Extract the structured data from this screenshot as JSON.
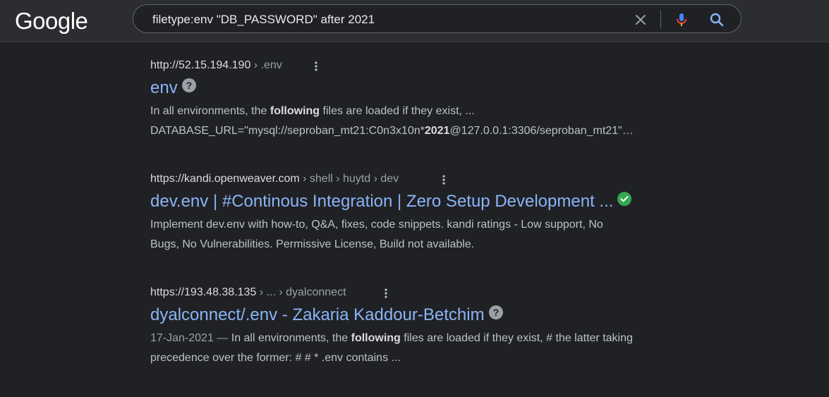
{
  "header": {
    "logo_text": "Google",
    "search_query": "filetype:env \"DB_PASSWORD\" after 2021"
  },
  "results": [
    {
      "url_base": "http://52.15.194.190",
      "url_path": " › .env",
      "title": "env",
      "title_badge": "question-icon",
      "snippet_line1_pre": "In all environments, the ",
      "snippet_line1_bold": "following",
      "snippet_line1_post": " files are loaded if they exist, ...",
      "snippet_line2_pre": "DATABASE_URL=\"mysql://seproban_mt21:C0n3x10n*",
      "snippet_line2_bold": "2021",
      "snippet_line2_post": "@127.0.0.1:3306/seproban_mt21\"…"
    },
    {
      "url_base": "https://kandi.openweaver.com",
      "url_path": " › shell › huytd › dev",
      "title": "dev.env | #Continous Integration | Zero Setup Development ...",
      "title_badge": "verified-check-icon",
      "snippet_line1": "Implement dev.env with how-to, Q&A, fixes, code snippets. kandi ratings - Low support, No",
      "snippet_line2": "Bugs, No Vulnerabilities. Permissive License, Build not available."
    },
    {
      "url_base": "https://193.48.38.135",
      "url_path": " › ... › dyalconnect",
      "title": "dyalconnect/.env - Zakaria Kaddour-Betchim",
      "title_badge": "question-icon",
      "date": "17-Jan-2021 —",
      "snippet_line1_pre": " In all environments, the ",
      "snippet_line1_bold": "following",
      "snippet_line1_post": " files are loaded if they exist, # the latter taking",
      "snippet_line2": "precedence over the former: # # * .env contains ..."
    }
  ],
  "colors": {
    "background": "#202124",
    "header": "#2c2d30",
    "link": "#8ab4f8",
    "verified": "#34a853"
  }
}
